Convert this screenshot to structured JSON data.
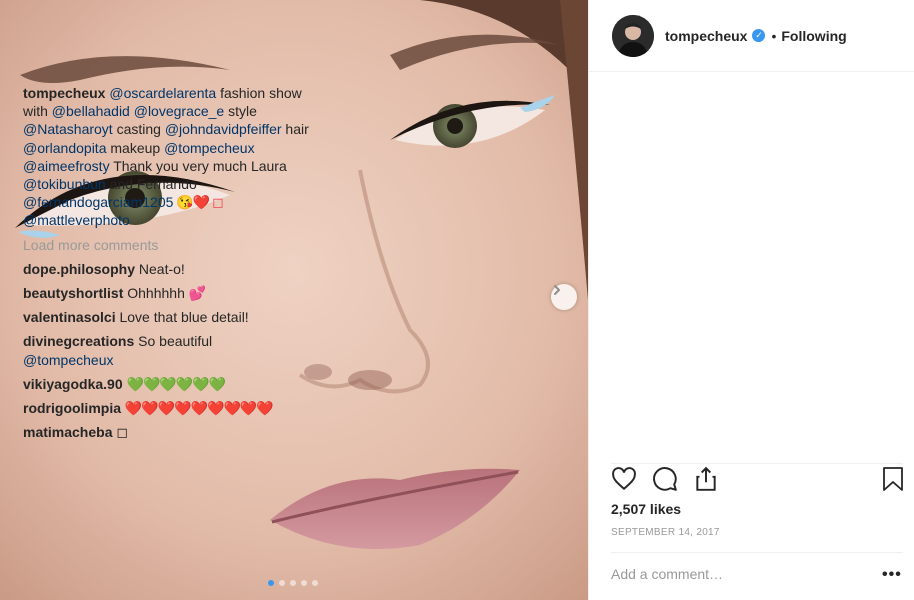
{
  "post": {
    "username": "tompecheux",
    "verified_mark": "✓",
    "follow_label": "Following",
    "bullet": "•"
  },
  "caption": {
    "user": "tompecheux",
    "parts": [
      {
        "type": "mention",
        "text": "@oscardelarenta"
      },
      {
        "type": "text",
        "text": " fashion show with "
      },
      {
        "type": "mention",
        "text": "@bellahadid"
      },
      {
        "type": "text",
        "text": " "
      },
      {
        "type": "mention",
        "text": "@lovegrace_e"
      },
      {
        "type": "text",
        "text": " style "
      },
      {
        "type": "mention",
        "text": "@Natasharoyt"
      },
      {
        "type": "text",
        "text": " casting "
      },
      {
        "type": "mention",
        "text": "@johndavidpfeiffer"
      },
      {
        "type": "text",
        "text": " hair "
      },
      {
        "type": "mention",
        "text": "@orlandopita"
      },
      {
        "type": "text",
        "text": " makeup "
      },
      {
        "type": "mention",
        "text": "@tompecheux"
      },
      {
        "type": "text",
        "text": " "
      },
      {
        "type": "mention",
        "text": "@aimeefrosty"
      },
      {
        "type": "text",
        "text": " Thank you very much Laura "
      },
      {
        "type": "mention",
        "text": "@tokibunbun"
      },
      {
        "type": "text",
        "text": " and Fernando "
      },
      {
        "type": "mention",
        "text": "@fernandogarciam1205"
      },
      {
        "type": "emoji",
        "text": " 😘❤️ ◻ "
      },
      {
        "type": "mention",
        "text": "@mattleverphoto"
      }
    ]
  },
  "load_more_label": "Load more comments",
  "comments": [
    {
      "user": "dope.philosophy",
      "text": "Neat-o!",
      "emoji": ""
    },
    {
      "user": "beautyshortlist",
      "text": "Ohhhhhh",
      "emoji": "💕"
    },
    {
      "user": "valentinasolci",
      "text": "Love that blue detail!",
      "emoji": ""
    },
    {
      "user": "divinegcreations",
      "text": "So beautiful",
      "mention": "@tompecheux",
      "emoji": ""
    },
    {
      "user": "vikiyagodka.90",
      "text": "",
      "emoji": "💚💚💚💚💚💚"
    },
    {
      "user": "rodrigoolimpia",
      "text": "",
      "emoji": "❤️❤️❤️❤️❤️❤️❤️❤️❤️"
    },
    {
      "user": "matimacheba",
      "text": "◻",
      "emoji": ""
    }
  ],
  "likes_label": "2,507 likes",
  "date_label": "SEPTEMBER 14, 2017",
  "add_comment_placeholder": "Add a comment…",
  "more_options_label": "•••",
  "icons": {
    "like": "heart-icon",
    "comment": "comment-icon",
    "share": "share-icon",
    "save": "bookmark-icon",
    "next": "chevron-right-icon"
  },
  "carousel": {
    "total_slides": 5,
    "active_slide": 1
  },
  "colors": {
    "mention": "#003569",
    "muted": "#999999",
    "text": "#262626",
    "accent": "#3897f0"
  }
}
